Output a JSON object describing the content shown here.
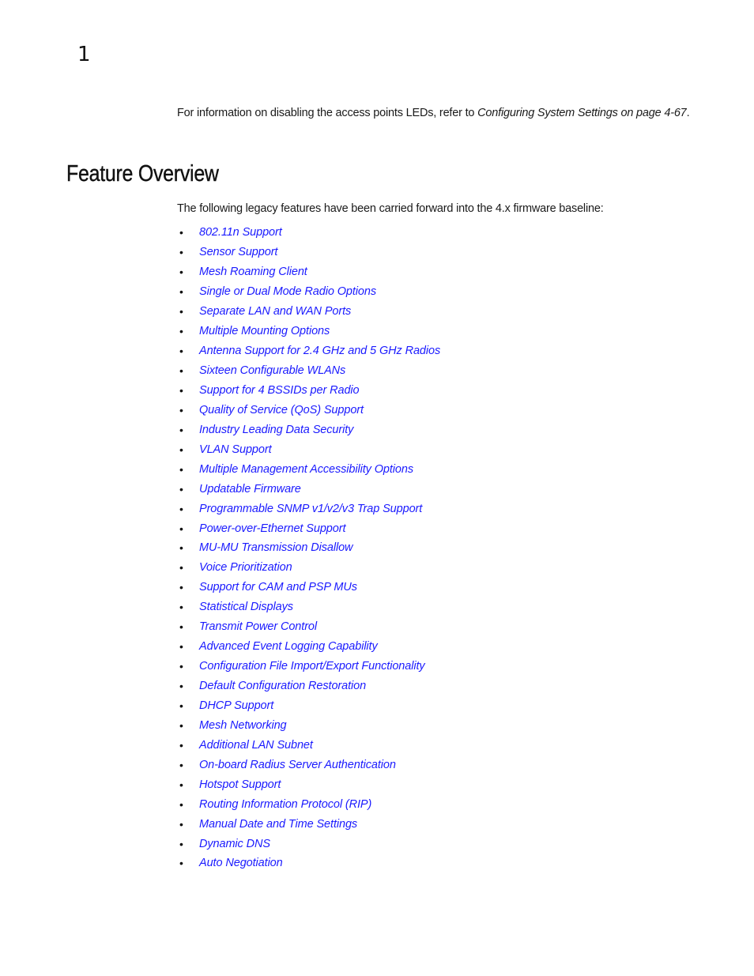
{
  "page": {
    "chapter_number": "1"
  },
  "intro": {
    "text_before": "For information on disabling the access points LEDs, refer to ",
    "link_text": "Configuring System Settings on page 4-67",
    "text_after": "."
  },
  "section": {
    "title": "Feature Overview",
    "lead": "The following legacy features have been carried forward into the 4.x firmware baseline:",
    "bullet_glyph": "•"
  },
  "colors": {
    "link": "#1a1aff",
    "text": "#1a1a1a"
  },
  "features": [
    "802.11n Support",
    "Sensor Support",
    "Mesh Roaming Client",
    "Single or Dual Mode Radio Options",
    "Separate LAN and WAN Ports",
    "Multiple Mounting Options",
    "Antenna Support for 2.4 GHz and 5 GHz Radios",
    "Sixteen Configurable WLANs",
    "Support for 4 BSSIDs per Radio",
    "Quality of Service (QoS) Support",
    "Industry Leading Data Security",
    "VLAN Support",
    "Multiple Management Accessibility Options",
    "Updatable Firmware",
    "Programmable SNMP v1/v2/v3 Trap Support",
    "Power-over-Ethernet Support",
    "MU-MU Transmission Disallow",
    "Voice Prioritization",
    "Support for CAM and PSP MUs",
    "Statistical Displays",
    "Transmit Power Control",
    "Advanced Event Logging Capability",
    "Configuration File Import/Export Functionality",
    "Default Configuration Restoration",
    "DHCP Support",
    "Mesh Networking",
    "Additional LAN Subnet",
    "On-board Radius Server Authentication",
    "Hotspot Support",
    "Routing Information Protocol (RIP)",
    "Manual Date and Time Settings",
    "Dynamic DNS",
    "Auto Negotiation"
  ]
}
